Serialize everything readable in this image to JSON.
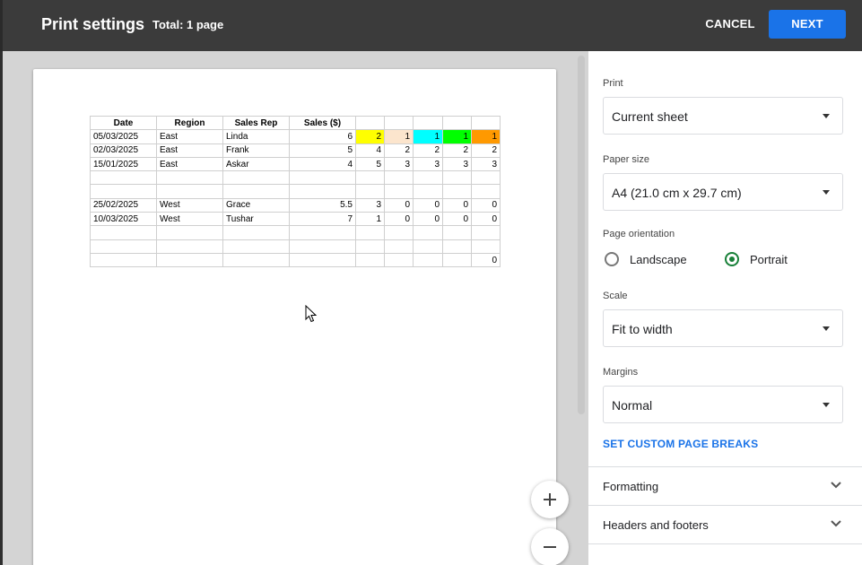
{
  "header": {
    "title": "Print settings",
    "total": "Total: 1 page",
    "cancel_label": "CANCEL",
    "next_label": "NEXT"
  },
  "sheet": {
    "headers": [
      "Date",
      "Region",
      "Sales Rep",
      "Sales ($)",
      "",
      "",
      "",
      "",
      "",
      ""
    ],
    "rows": [
      [
        "05/03/2025",
        "East",
        "Linda",
        "6",
        "2",
        "1",
        "1",
        "1",
        "1"
      ],
      [
        "02/03/2025",
        "East",
        "Frank",
        "5",
        "4",
        "2",
        "2",
        "2",
        "2"
      ],
      [
        "15/01/2025",
        "East",
        "Askar",
        "4",
        "5",
        "3",
        "3",
        "3",
        "3"
      ],
      [
        "",
        "",
        "",
        "",
        "",
        "",
        "",
        "",
        ""
      ],
      [
        "",
        "",
        "",
        "",
        "",
        "",
        "",
        "",
        ""
      ],
      [
        "25/02/2025",
        "West",
        "Grace",
        "5.5",
        "3",
        "0",
        "0",
        "0",
        "0"
      ],
      [
        "10/03/2025",
        "West",
        "Tushar",
        "7",
        "1",
        "0",
        "0",
        "0",
        "0"
      ],
      [
        "",
        "",
        "",
        "",
        "",
        "",
        "",
        "",
        ""
      ],
      [
        "",
        "",
        "",
        "",
        "",
        "",
        "",
        "",
        ""
      ],
      [
        "",
        "",
        "",
        "",
        "",
        "",
        "",
        "",
        "0"
      ]
    ],
    "highlight_colors": [
      "#ffff00",
      "#fce5cd",
      "#00ffff",
      "#00ff00",
      "#ff9900"
    ]
  },
  "settings": {
    "print_label": "Print",
    "print_value": "Current sheet",
    "paper_label": "Paper size",
    "paper_value": "A4 (21.0 cm x 29.7 cm)",
    "orientation_label": "Page orientation",
    "landscape_label": "Landscape",
    "portrait_label": "Portrait",
    "selected_orientation": "Portrait",
    "scale_label": "Scale",
    "scale_value": "Fit to width",
    "margins_label": "Margins",
    "margins_value": "Normal",
    "custom_breaks_label": "SET CUSTOM PAGE BREAKS",
    "formatting_label": "Formatting",
    "headers_footers_label": "Headers and footers"
  },
  "icons": {
    "zoom_in": "plus-icon",
    "zoom_out": "minus-icon",
    "expand": "chevron-down-icon",
    "dropdown": "caret-down-icon",
    "cursor": "mouse-pointer-icon"
  },
  "colors": {
    "header_bg": "#3b3b3b",
    "accent": "#1a73e8",
    "radio_selected": "#188038"
  }
}
